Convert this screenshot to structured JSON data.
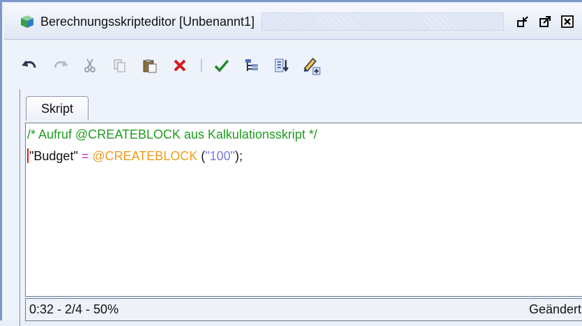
{
  "window": {
    "title": "Berechnungsskripteditor [Unbenannt1]",
    "buttons": {
      "minimize": "minimize-window-icon",
      "maximize": "maximize-window-icon",
      "close": "close-window-icon"
    }
  },
  "toolbar": {
    "items": [
      "undo-icon",
      "redo-icon",
      "cut-icon",
      "copy-icon",
      "paste-icon",
      "delete-icon",
      "validate-icon",
      "member-tree-icon",
      "insert-function-icon",
      "edit-pencil-icon"
    ]
  },
  "tabs": [
    {
      "label": "Skript",
      "active": true
    }
  ],
  "editor": {
    "line1": "/* Aufruf @CREATEBLOCK aus Kalkulationsskript */",
    "line2": {
      "target": "\"Budget\" ",
      "op": "=",
      "fn": " @CREATEBLOCK",
      "open": " (",
      "arg": "\"100\"",
      "close": ");"
    }
  },
  "status": {
    "position": "0:32 - 2/4 - 50%",
    "state": "Geändert"
  },
  "colors": {
    "comment": "#1d9b1d",
    "operator": "#cc2fcc",
    "function": "#f09a1a",
    "string": "#7a7ae0",
    "cursor": "#e01a1a"
  }
}
